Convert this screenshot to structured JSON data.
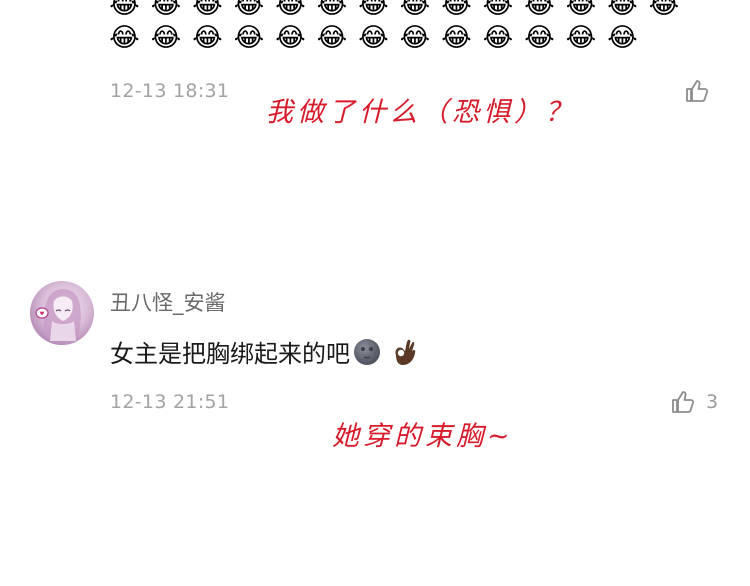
{
  "previous_comment": {
    "emoji_rows": [
      [
        "😂",
        "😂",
        "😂",
        "😂",
        "😂",
        "😂",
        "😂",
        "😂",
        "😂",
        "😂",
        "😂",
        "😂",
        "😂",
        "😂"
      ],
      [
        "😂",
        "😂",
        "😂",
        "😂",
        "😂",
        "😂",
        "😂",
        "😂",
        "😂",
        "😂",
        "😂",
        "😂",
        "😂"
      ]
    ],
    "timestamp": "12-13 18:31",
    "like_icon": "thumbs-up-outline-icon"
  },
  "annotations": {
    "first": "我做了什么（恐惧）？",
    "second": "她穿的束胸~"
  },
  "comment": {
    "username": "丑八怪_安酱",
    "text": "女主是把胸绑起来的吧",
    "emojis": [
      "new-moon-face-icon",
      "ok-hand-icon"
    ],
    "timestamp": "12-13 21:51",
    "likes": "3",
    "like_icon": "thumbs-up-outline-icon"
  },
  "colors": {
    "annotation_red": "#d81b2b",
    "timestamp_gray": "#a3a3a3",
    "username_gray": "#6a6a6a"
  }
}
